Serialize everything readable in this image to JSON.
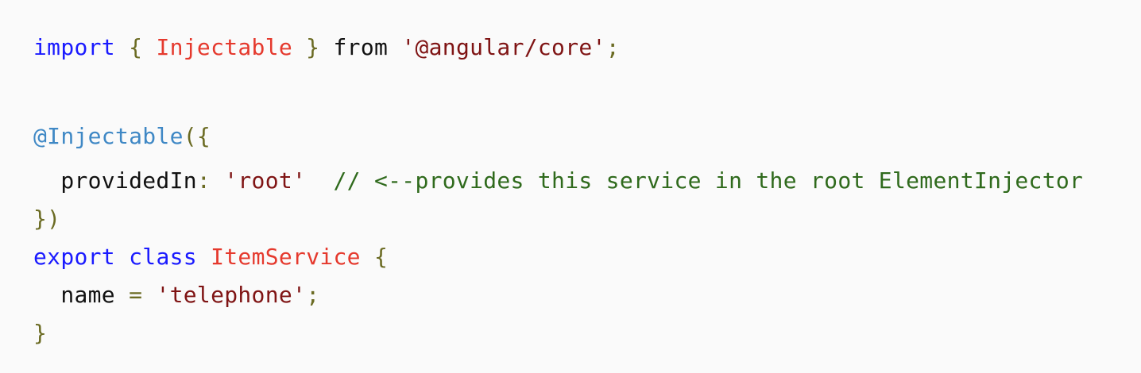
{
  "code": {
    "line1": {
      "kw_import": "import",
      "brace_open": " { ",
      "type_injectable": "Injectable",
      "brace_close": " } ",
      "kw_from": "from",
      "space": " ",
      "module_string": "'@angular/core'",
      "semicolon": ";"
    },
    "line2": {
      "decorator": "@Injectable",
      "punct": "({"
    },
    "line3": {
      "indent": "  ",
      "key": "providedIn",
      "colon": ": ",
      "value": "'root'",
      "gap": "  ",
      "comment": "// <--provides this service in the root ElementInjector"
    },
    "line4": {
      "punct": "})"
    },
    "line5": {
      "kw_export": "export",
      "space1": " ",
      "kw_class": "class",
      "space2": " ",
      "class_name": "ItemService",
      "brace": " {"
    },
    "line6": {
      "indent": "  ",
      "prop": "name",
      "equals": " = ",
      "value": "'telephone'",
      "semicolon": ";"
    },
    "line7": {
      "brace": "}"
    }
  },
  "colors": {
    "keyword": "#1a1aff",
    "punctuation": "#6b6b23",
    "type": "#e5392d",
    "plain": "#111111",
    "string": "#7f1414",
    "decorator": "#3f88c5",
    "comment": "#2f6a1c",
    "background": "#fafafa"
  }
}
